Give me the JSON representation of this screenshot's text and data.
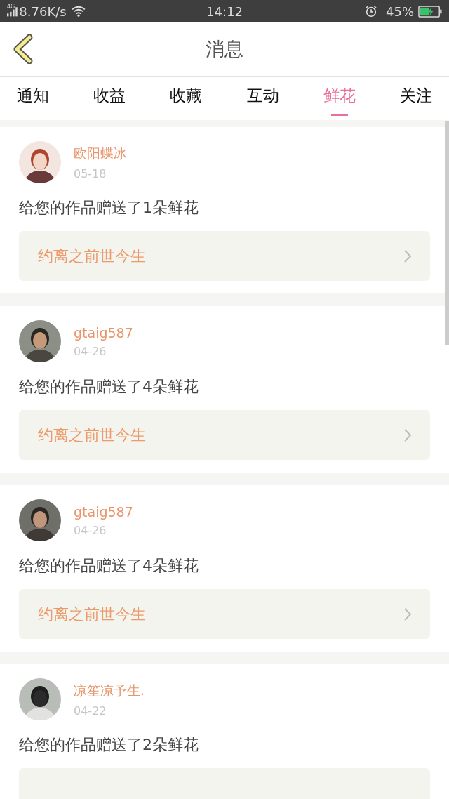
{
  "status_bar": {
    "network": "4G",
    "speed": "8.76K/s",
    "time": "14:12",
    "battery": "45%"
  },
  "header": {
    "title": "消息"
  },
  "tabs": [
    {
      "label": "通知",
      "selected": false
    },
    {
      "label": "收益",
      "selected": false
    },
    {
      "label": "收藏",
      "selected": false
    },
    {
      "label": "互动",
      "selected": false
    },
    {
      "label": "鲜花",
      "selected": true
    },
    {
      "label": "关注",
      "selected": false
    }
  ],
  "messages": [
    {
      "name": "欧阳蝶冰",
      "date": "05-18",
      "text": "给您的作品赠送了1朵鲜花",
      "book": "约离之前世今生"
    },
    {
      "name": "gtaig587",
      "date": "04-26",
      "text": "给您的作品赠送了4朵鲜花",
      "book": "约离之前世今生"
    },
    {
      "name": "gtaig587",
      "date": "04-26",
      "text": "给您的作品赠送了4朵鲜花",
      "book": "约离之前世今生"
    },
    {
      "name": "凉笙凉予生.",
      "date": "04-22",
      "text": "给您的作品赠送了2朵鲜花"
    }
  ]
}
